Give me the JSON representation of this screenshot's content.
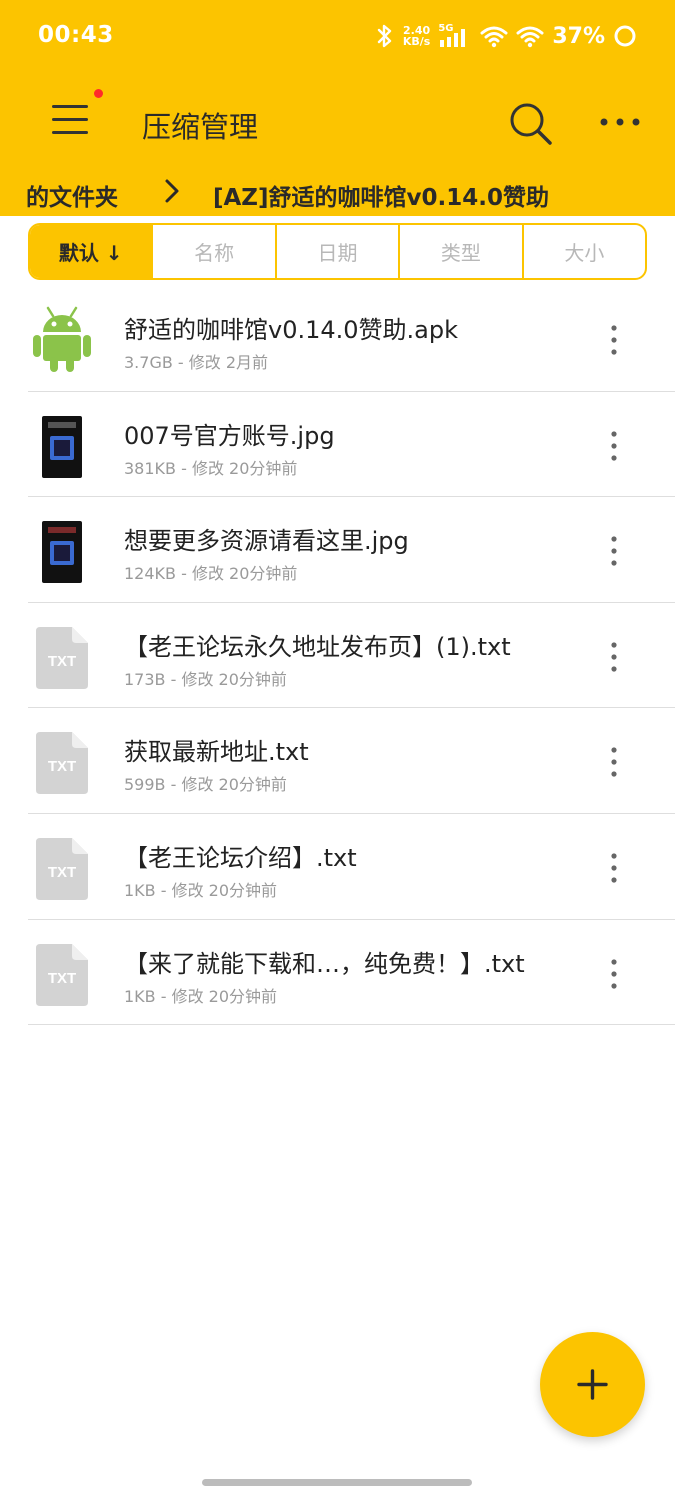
{
  "status_bar": {
    "time": "00:43",
    "net_speed_value": "2.40",
    "net_speed_unit": "KB/s",
    "network_type": "5G",
    "battery": "37%"
  },
  "app_bar": {
    "title": "压缩管理",
    "accent_color": "#fcc400",
    "icons": [
      "menu-icon",
      "search-icon",
      "more-icon"
    ]
  },
  "breadcrumb": {
    "items": [
      "的文件夹",
      "[AZ]舒适的咖啡馆v0.14.0赞助"
    ]
  },
  "sort_tabs": [
    {
      "label": "默认 ↓",
      "selected": true
    },
    {
      "label": "名称",
      "selected": false
    },
    {
      "label": "日期",
      "selected": false
    },
    {
      "label": "类型",
      "selected": false
    },
    {
      "label": "大小",
      "selected": false
    }
  ],
  "files": [
    {
      "name": "舒适的咖啡馆v0.14.0赞助.apk",
      "meta": "3.7GB - 修改 2月前",
      "icon": "android-icon"
    },
    {
      "name": "007号官方账号.jpg",
      "meta": "381KB - 修改 20分钟前",
      "icon": "image-thumbnail"
    },
    {
      "name": "想要更多资源请看这里.jpg",
      "meta": "124KB - 修改 20分钟前",
      "icon": "image-thumbnail"
    },
    {
      "name": "【老王论坛永久地址发布页】(1).txt",
      "meta": "173B - 修改 20分钟前",
      "icon": "txt-file-icon",
      "icon_label": "TXT"
    },
    {
      "name": "获取最新地址.txt",
      "meta": "599B - 修改 20分钟前",
      "icon": "txt-file-icon",
      "icon_label": "TXT"
    },
    {
      "name": "【老王论坛介绍】.txt",
      "meta": "1KB - 修改 20分钟前",
      "icon": "txt-file-icon",
      "icon_label": "TXT"
    },
    {
      "name": "【来了就能下载和…，纯免费！】.txt",
      "meta": "1KB - 修改 20分钟前",
      "icon": "txt-file-icon",
      "icon_label": "TXT"
    }
  ],
  "fab": {
    "icon": "plus-icon"
  }
}
